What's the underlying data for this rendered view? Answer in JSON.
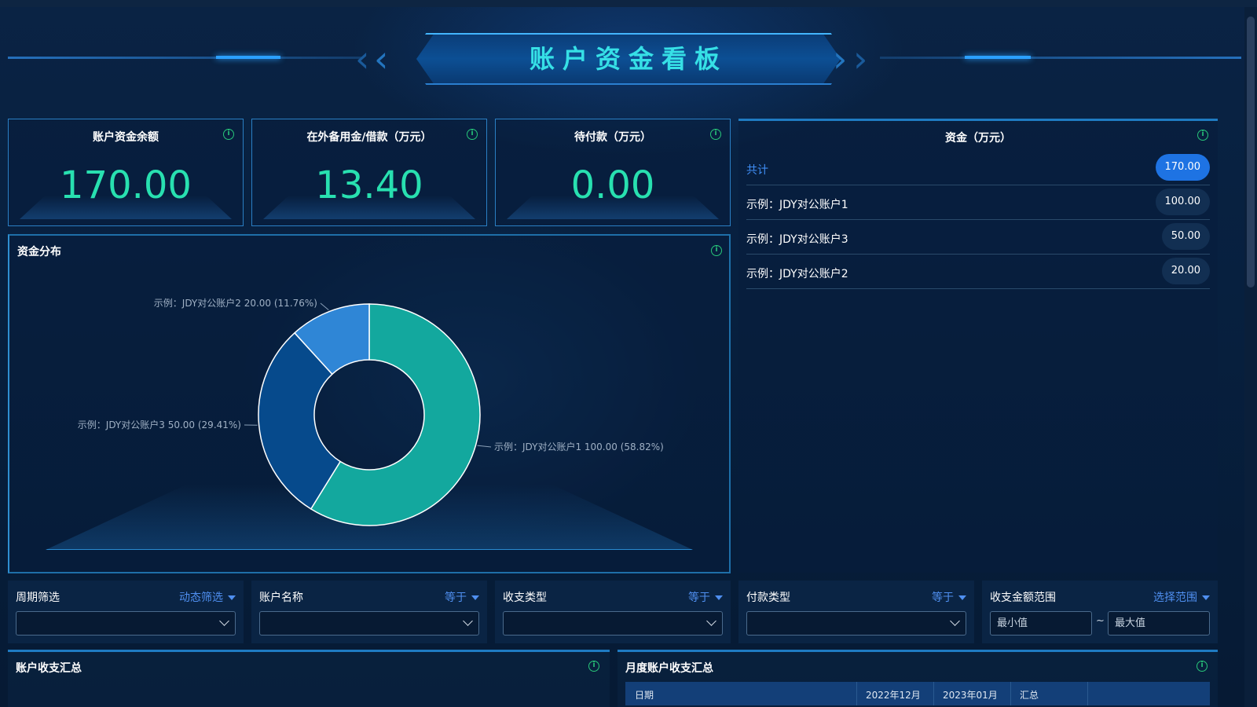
{
  "header": {
    "title": "账户资金看板"
  },
  "kpis": [
    {
      "title": "账户资金余额",
      "value": "170.00"
    },
    {
      "title": "在外备用金/借款（万元）",
      "value": "13.40"
    },
    {
      "title": "待付款（万元）",
      "value": "0.00"
    }
  ],
  "funds": {
    "title": "资金（万元）",
    "rows": [
      {
        "label": "共计",
        "value": "170.00"
      },
      {
        "label": "示例：JDY对公账户1",
        "value": "100.00"
      },
      {
        "label": "示例：JDY对公账户3",
        "value": "50.00"
      },
      {
        "label": "示例：JDY对公账户2",
        "value": "20.00"
      }
    ]
  },
  "distribution": {
    "title": "资金分布"
  },
  "chart_data": {
    "type": "pie",
    "donut": true,
    "slices": [
      {
        "label": "示例：JDY对公账户1 100.00 (58.82%)",
        "name": "示例：JDY对公账户1",
        "value": 100.0,
        "percent": 58.82,
        "color": "#13a89e"
      },
      {
        "label": "示例：JDY对公账户3 50.00 (29.41%)",
        "name": "示例：JDY对公账户3",
        "value": 50.0,
        "percent": 29.41,
        "color": "#064a8c"
      },
      {
        "label": "示例：JDY对公账户2 20.00 (11.76%)",
        "name": "示例：JDY对公账户2",
        "value": 20.0,
        "percent": 11.76,
        "color": "#2f86d6"
      }
    ]
  },
  "filters": [
    {
      "label": "周期筛选",
      "op": "动态筛选"
    },
    {
      "label": "账户名称",
      "op": "等于"
    },
    {
      "label": "收支类型",
      "op": "等于"
    },
    {
      "label": "付款类型",
      "op": "等于"
    },
    {
      "label": "收支金额范围",
      "op": "选择范围",
      "min_placeholder": "最小值",
      "max_placeholder": "最大值",
      "separator": "~"
    }
  ],
  "bottom": {
    "left_title": "账户收支汇总",
    "right_title": "月度账户收支汇总",
    "table_headers": [
      "日期",
      "2022年12月",
      "2023年01月",
      "汇总",
      ""
    ]
  },
  "colors": {
    "accent": "#28e0b0",
    "title": "#36e0e6",
    "link": "#4f8ff0",
    "info": "#28c77a"
  }
}
